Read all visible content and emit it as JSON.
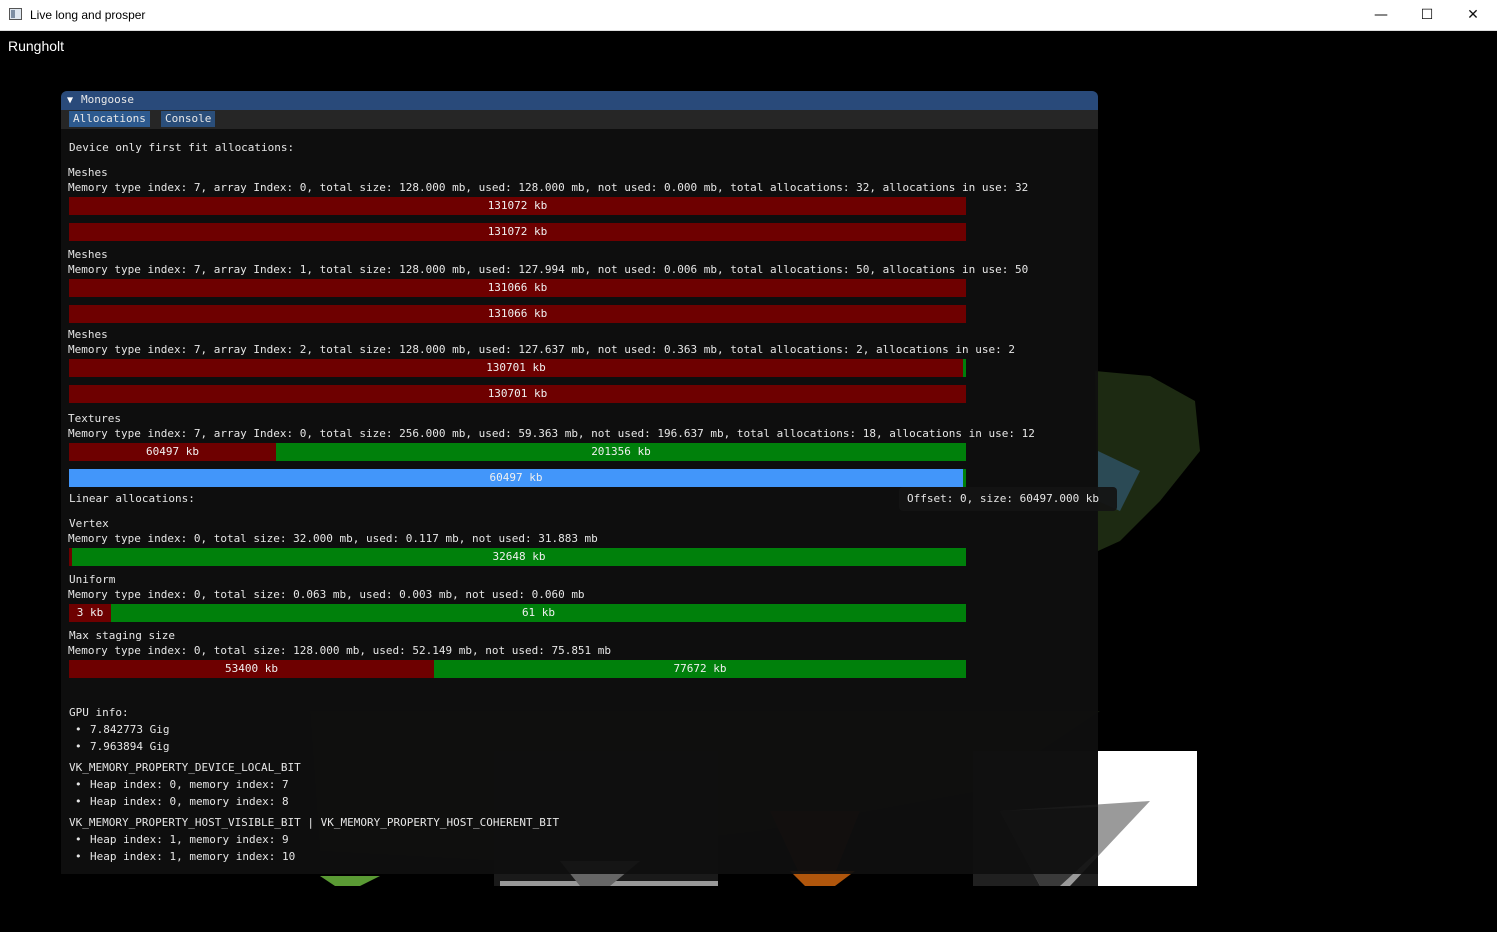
{
  "window": {
    "title": "Live long and prosper",
    "minimize": "—",
    "maximize": "☐",
    "close": "✕"
  },
  "scene": {
    "title": "Rungholt"
  },
  "panel": {
    "title": "Mongoose",
    "collapse_icon": "▼",
    "tabs": [
      "Allocations",
      "Console"
    ],
    "first_fit_header": "Device only first fit allocations:",
    "groups": [
      {
        "name": "Meshes",
        "info": "Memory type index: 7, array Index: 0, total size: 128.000 mb, used: 128.000 mb, not used: 0.000 mb, total allocations: 32, allocations in use: 32",
        "bar1_label": "131072 kb",
        "bar2_label": "131072 kb"
      },
      {
        "name": "Meshes",
        "info": "Memory type index: 7, array Index: 1, total size: 128.000 mb, used: 127.994 mb, not used: 0.006 mb, total allocations: 50, allocations in use: 50",
        "bar1_label": "131066 kb",
        "bar2_label": "131066 kb"
      },
      {
        "name": "Meshes",
        "info": "Memory type index: 7, array Index: 2, total size: 128.000 mb, used: 127.637 mb, not used: 0.363 mb, total allocations: 2, allocations in use: 2",
        "bar1_label": "130701 kb",
        "bar2_label": "130701 kb"
      },
      {
        "name": "Textures",
        "info": "Memory type index: 7, array Index: 0, total size: 256.000 mb, used: 59.363 mb, not used: 196.637 mb, total allocations: 18, allocations in use: 12",
        "bar1_used_label": "60497 kb",
        "bar1_free_label": "201356 kb",
        "bar2_label": "60497 kb"
      }
    ],
    "linear_header": "Linear allocations:",
    "linear": [
      {
        "name": "Vertex",
        "info": "Memory type index: 0, total size: 32.000 mb, used: 0.117 mb, not used: 31.883 mb",
        "used_label": "",
        "free_label": "32648 kb",
        "used_fraction": 0.0037
      },
      {
        "name": "Uniform",
        "info": "Memory type index: 0, total size: 0.063 mb, used: 0.003 mb, not used: 0.060 mb",
        "used_label": "3 kb",
        "free_label": "61 kb",
        "used_fraction": 0.047
      },
      {
        "name": "Max staging size",
        "info": "Memory type index: 0, total size: 128.000 mb, used: 52.149 mb, not used: 75.851 mb",
        "used_label": "53400 kb",
        "free_label": "77672 kb",
        "used_fraction": 0.407
      }
    ],
    "gpu_header": "GPU info:",
    "gpu_items": [
      "7.842773 Gig",
      "7.963894 Gig"
    ],
    "device_local_header": "VK_MEMORY_PROPERTY_DEVICE_LOCAL_BIT",
    "device_local_items": [
      "Heap index: 0, memory index: 7",
      "Heap index: 0, memory index: 8"
    ],
    "host_visible_header": "VK_MEMORY_PROPERTY_HOST_VISIBLE_BIT | VK_MEMORY_PROPERTY_HOST_COHERENT_BIT",
    "host_visible_items": [
      "Heap index: 1, memory index: 9",
      "Heap index: 1, memory index: 10"
    ],
    "bullet": "•"
  },
  "tooltip": {
    "text": "Offset: 0, size: 60497.000 kb"
  },
  "colors": {
    "used": "#6e0000",
    "free": "#00800b",
    "hover": "#4296fa",
    "title_bar": "#294a7a"
  }
}
